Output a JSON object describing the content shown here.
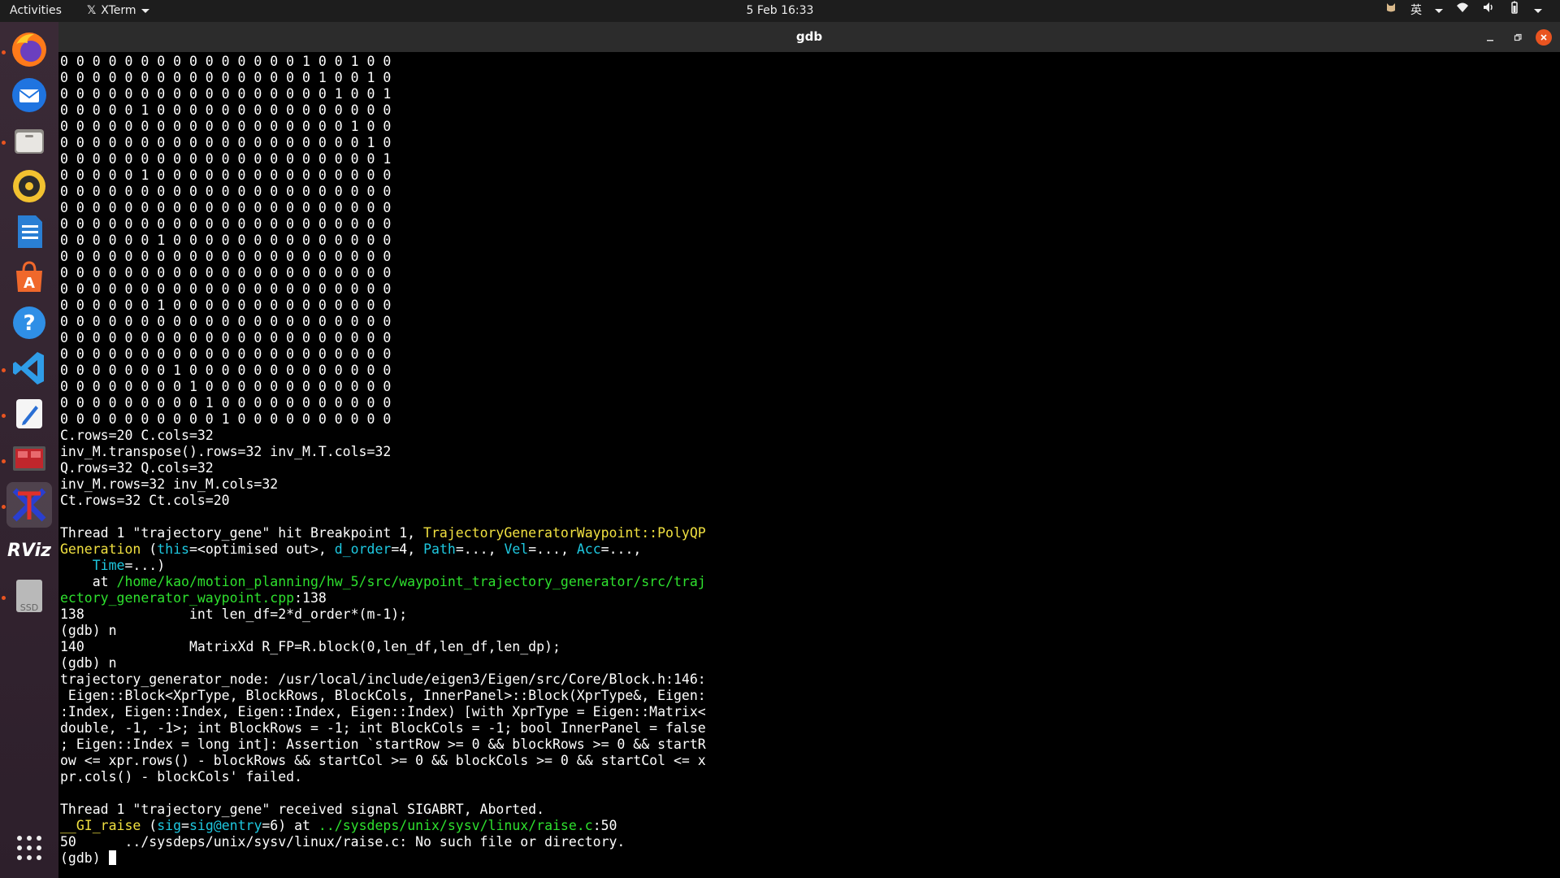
{
  "topbar": {
    "activities": "Activities",
    "app_name": "XTerm",
    "clock": "5 Feb  16:33",
    "input_method": "英"
  },
  "dock": {
    "items": [
      {
        "name": "firefox"
      },
      {
        "name": "thunderbird"
      },
      {
        "name": "files"
      },
      {
        "name": "rhythmbox"
      },
      {
        "name": "libreoffice-writer"
      },
      {
        "name": "ubuntu-software"
      },
      {
        "name": "help"
      },
      {
        "name": "vscode"
      },
      {
        "name": "text-editor"
      },
      {
        "name": "screen-app"
      },
      {
        "name": "xterm"
      },
      {
        "name": "rviz"
      },
      {
        "name": "ssd-drive"
      }
    ],
    "rviz_label": "RViz",
    "ssd_label": "SSD"
  },
  "window": {
    "title": "gdb"
  },
  "terminal": {
    "matrix_rows": [
      "0 0 0 0 0 0 0 0 0 0 0 0 0 0 0 1 0 0 1 0 0",
      "0 0 0 0 0 0 0 0 0 0 0 0 0 0 0 0 1 0 0 1 0",
      "0 0 0 0 0 0 0 0 0 0 0 0 0 0 0 0 0 1 0 0 1",
      "0 0 0 0 0 1 0 0 0 0 0 0 0 0 0 0 0 0 0 0 0",
      "0 0 0 0 0 0 0 0 0 0 0 0 0 0 0 0 0 0 1 0 0",
      "0 0 0 0 0 0 0 0 0 0 0 0 0 0 0 0 0 0 0 1 0",
      "0 0 0 0 0 0 0 0 0 0 0 0 0 0 0 0 0 0 0 0 1",
      "0 0 0 0 0 1 0 0 0 0 0 0 0 0 0 0 0 0 0 0 0",
      "0 0 0 0 0 0 0 0 0 0 0 0 0 0 0 0 0 0 0 0 0",
      "0 0 0 0 0 0 0 0 0 0 0 0 0 0 0 0 0 0 0 0 0",
      "0 0 0 0 0 0 0 0 0 0 0 0 0 0 0 0 0 0 0 0 0",
      "0 0 0 0 0 0 1 0 0 0 0 0 0 0 0 0 0 0 0 0 0",
      "0 0 0 0 0 0 0 0 0 0 0 0 0 0 0 0 0 0 0 0 0",
      "0 0 0 0 0 0 0 0 0 0 0 0 0 0 0 0 0 0 0 0 0",
      "0 0 0 0 0 0 0 0 0 0 0 0 0 0 0 0 0 0 0 0 0",
      "0 0 0 0 0 0 1 0 0 0 0 0 0 0 0 0 0 0 0 0 0",
      "0 0 0 0 0 0 0 0 0 0 0 0 0 0 0 0 0 0 0 0 0",
      "0 0 0 0 0 0 0 0 0 0 0 0 0 0 0 0 0 0 0 0 0",
      "0 0 0 0 0 0 0 0 0 0 0 0 0 0 0 0 0 0 0 0 0",
      "0 0 0 0 0 0 0 1 0 0 0 0 0 0 0 0 0 0 0 0 0",
      "0 0 0 0 0 0 0 0 1 0 0 0 0 0 0 0 0 0 0 0 0",
      "0 0 0 0 0 0 0 0 0 1 0 0 0 0 0 0 0 0 0 0 0",
      "0 0 0 0 0 0 0 0 0 0 1 0 0 0 0 0 0 0 0 0 0"
    ],
    "out1": "C.rows=20 C.cols=32",
    "out2": "inv_M.transpose().rows=32 inv_M.T.cols=32",
    "out3": "Q.rows=32 Q.cols=32",
    "out4": "inv_M.rows=32 inv_M.cols=32",
    "out5": "Ct.rows=32 Ct.cols=20",
    "bp_prefix": "Thread 1 \"trajectory_gene\" hit Breakpoint 1, ",
    "bp_func1": "TrajectoryGeneratorWaypoint::PolyQP",
    "bp_func2": "Generation",
    "bp_sp1": " (",
    "arg_this": "this",
    "arg_this_val": "=<optimised out>, ",
    "arg_dorder": "d_order",
    "arg_dorder_val": "=4, ",
    "arg_path": "Path",
    "arg_path_val": "=..., ",
    "arg_vel": "Vel",
    "arg_vel_val": "=..., ",
    "arg_acc": "Acc",
    "arg_acc_val": "=...,",
    "arg_indent": "    ",
    "arg_time": "Time",
    "arg_time_val": "=...)",
    "at_prefix": "    at ",
    "path1": "/home/kao/motion_planning/hw_5/src/waypoint_trajectory_generator/src/traj",
    "path2": "ectory_generator_waypoint.cpp",
    "path2_line": ":138",
    "src138": "138             int len_df=2*d_order*(m-1);",
    "prompt_n1": "(gdb) n",
    "src140": "140             MatrixXd R_FP=R.block(0,len_df,len_df,len_dp);",
    "prompt_n2": "(gdb) n",
    "err1": "trajectory_generator_node: /usr/local/include/eigen3/Eigen/src/Core/Block.h:146:",
    "err2": " Eigen::Block<XprType, BlockRows, BlockCols, InnerPanel>::Block(XprType&, Eigen:",
    "err3": ":Index, Eigen::Index, Eigen::Index, Eigen::Index) [with XprType = Eigen::Matrix<",
    "err4": "double, -1, -1>; int BlockRows = -1; int BlockCols = -1; bool InnerPanel = false",
    "err5": "; Eigen::Index = long int]: Assertion `startRow >= 0 && blockRows >= 0 && startR",
    "err6": "ow <= xpr.rows() - blockRows && startCol >= 0 && blockCols >= 0 && startCol <= x",
    "err7": "pr.cols() - blockCols' failed.",
    "sig_line": "Thread 1 \"trajectory_gene\" received signal SIGABRT, Aborted.",
    "raise_func": "__GI_raise",
    "raise_sp1": " (",
    "raise_arg": "sig",
    "raise_arg_val": "=",
    "raise_arg_val2": "sig@entry",
    "raise_mid": "=6) at ",
    "raise_path": "../sysdeps/unix/sysv/linux/raise.c",
    "raise_line": ":50",
    "nofile": "50      ../sysdeps/unix/sysv/linux/raise.c: No such file or directory.",
    "prompt_final": "(gdb) "
  },
  "colors": {
    "highlight_yellow": "#f0e040",
    "highlight_cyan": "#1ec8e0",
    "highlight_green": "#2ee02e",
    "close_button": "#e95420"
  }
}
